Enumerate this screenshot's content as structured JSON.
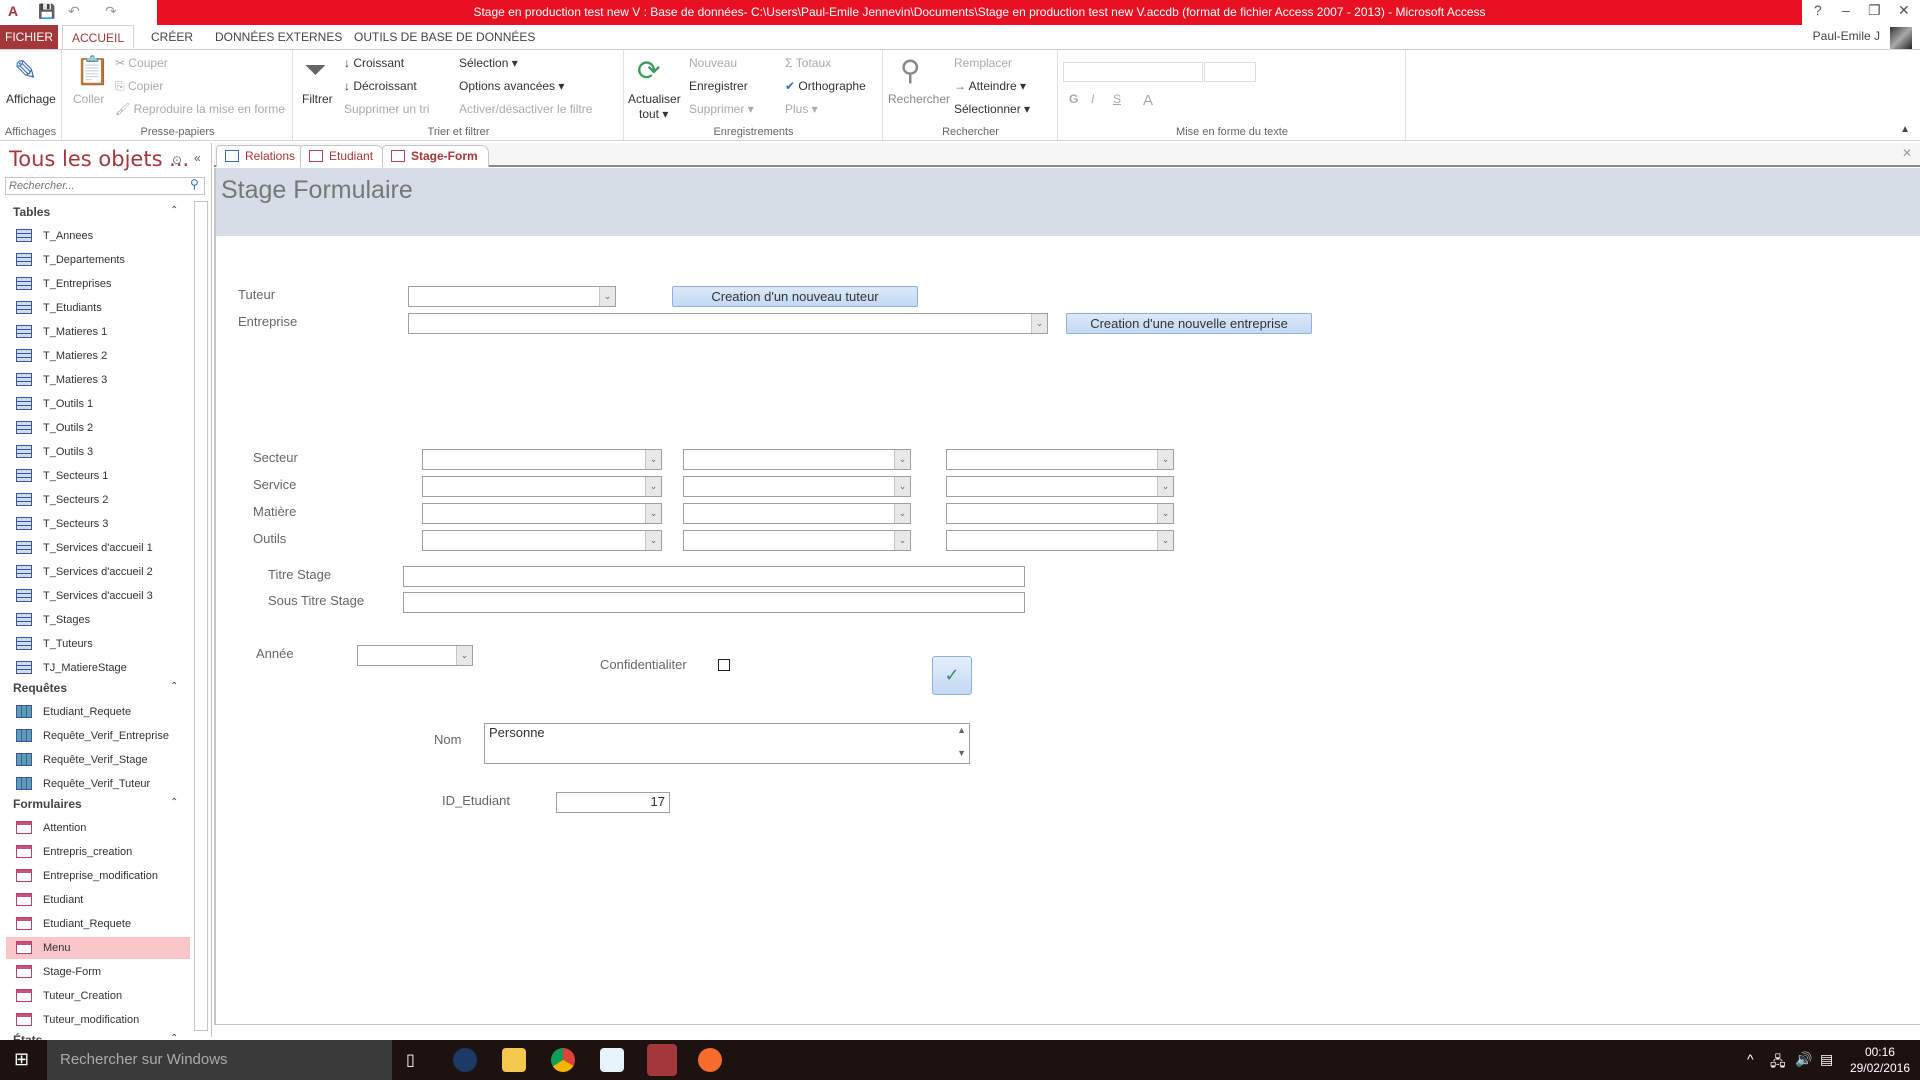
{
  "window": {
    "title": "Stage en production test new V : Base de données- C:\\Users\\Paul-Emile Jennevin\\Documents\\Stage en production test new V.accdb (format de fichier Access 2007 - 2013) -  Microsoft Access",
    "help": "?",
    "minimize": "–",
    "restore": "❐",
    "close": "✕",
    "user": "Paul-Emile J",
    "app_icon": "A",
    "save_icon": "💾",
    "undo_icon": "↶",
    "redo_icon": "↷"
  },
  "ribbon_tabs": [
    "FICHIER",
    "ACCUEIL",
    "CRÉER",
    "DONNÉES EXTERNES",
    "OUTILS DE BASE DE DONNÉES"
  ],
  "ribbon": {
    "affichages": {
      "label": "Affichages",
      "affichage": "Affichage"
    },
    "presse": {
      "label": "Presse-papiers",
      "coller": "Coller",
      "couper": "Couper",
      "copier": "Copier",
      "reproduire": "Reproduire la mise en forme"
    },
    "trier": {
      "label": "Trier et filtrer",
      "filtrer": "Filtrer",
      "croissant": "Croissant",
      "decroissant": "Décroissant",
      "supprimer_tri": "Supprimer un tri",
      "selection": "Sélection ▾",
      "options": "Options avancées ▾",
      "activer": "Activer/désactiver le filtre"
    },
    "enregistrements": {
      "label": "Enregistrements",
      "actualiser": "Actualiser",
      "tout": "tout ▾",
      "nouveau": "Nouveau",
      "enregistrer": "Enregistrer",
      "supprimer": "Supprimer ▾",
      "totaux": "Totaux",
      "orthographe": "Orthographe",
      "plus": "Plus ▾"
    },
    "rechercher": {
      "label": "Rechercher",
      "rechercher": "Rechercher",
      "remplacer": "Remplacer",
      "atteindre": "Atteindre ▾",
      "selectionner": "Sélectionner ▾"
    },
    "miseenforme": {
      "label": "Mise en forme du texte",
      "bold": "G",
      "italic": "I",
      "underline": "S",
      "fontcolor": "A"
    }
  },
  "nav": {
    "title": "Tous les objets ...",
    "search_placeholder": "Rechercher...",
    "sections": [
      {
        "name": "Tables",
        "type": "t",
        "items": [
          "T_Annees",
          "T_Departements",
          "T_Entreprises",
          "T_Etudiants",
          "T_Matieres 1",
          "T_Matieres 2",
          "T_Matieres 3",
          "T_Outils 1",
          "T_Outils 2",
          "T_Outils 3",
          "T_Secteurs 1",
          "T_Secteurs 2",
          "T_Secteurs 3",
          "T_Services d'accueil 1",
          "T_Services d'accueil 2",
          "T_Services d'accueil 3",
          "T_Stages",
          "T_Tuteurs",
          "TJ_MatiereStage"
        ]
      },
      {
        "name": "Requêtes",
        "type": "q",
        "items": [
          "Etudiant_Requete",
          "Requête_Verif_Entreprise",
          "Requête_Verif_Stage",
          "Requête_Verif_Tuteur"
        ]
      },
      {
        "name": "Formulaires",
        "type": "f",
        "items": [
          "Attention",
          "Entrepris_creation",
          "Entreprise_modification",
          "Etudiant",
          "Etudiant_Requete",
          "Menu",
          "Stage-Form",
          "Tuteur_Creation",
          "Tuteur_modification"
        ]
      },
      {
        "name": "États",
        "type": "r",
        "items": []
      }
    ],
    "selected": "Menu"
  },
  "doc_tabs": [
    "Relations",
    "Etudiant",
    "Stage-Form"
  ],
  "doc_tab_active": "Stage-Form",
  "form": {
    "title": "Stage Formulaire",
    "tuteur_label": "Tuteur",
    "tuteur_value": "",
    "entreprise_label": "Entreprise",
    "entreprise_value": "",
    "new_tuteur_button": "Creation d'un nouveau tuteur",
    "new_entreprise_button": "Creation d'une nouvelle entreprise",
    "grid_labels": [
      "Secteur",
      "Service",
      "Matière",
      "Outils"
    ],
    "titre_label": "Titre Stage",
    "titre_value": "",
    "sous_titre_label": "Sous Titre Stage",
    "sous_titre_value": "",
    "annee_label": "Année",
    "annee_value": "",
    "confidentialiter_label": "Confidentialiter",
    "confidentialiter_checked": false,
    "nom_label": "Nom",
    "nom_value": "Personne",
    "id_label": "ID_Etudiant",
    "id_value": "17",
    "ok_icon": "✓"
  },
  "taskbar": {
    "search": "Rechercher sur Windows",
    "time": "00:16",
    "date": "29/02/2016"
  }
}
